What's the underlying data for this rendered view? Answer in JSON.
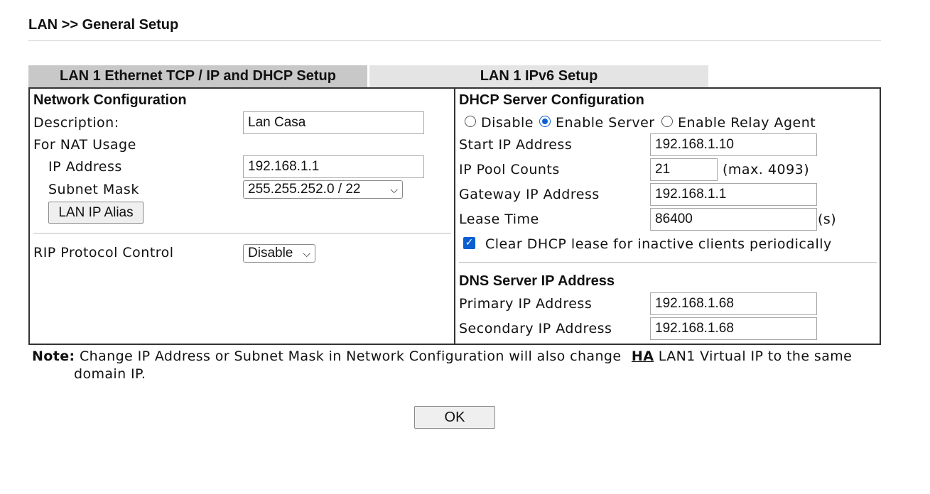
{
  "page": {
    "title": "LAN >> General Setup"
  },
  "tabs": [
    {
      "label": "LAN 1 Ethernet TCP / IP and DHCP Setup",
      "active": true
    },
    {
      "label": "LAN 1 IPv6 Setup",
      "active": false
    }
  ],
  "network": {
    "heading": "Network Configuration",
    "description_label": "Description:",
    "description_value": "Lan Casa",
    "nat_label": "For NAT Usage",
    "ip_label": "IP Address",
    "ip_value": "192.168.1.1",
    "subnet_label": "Subnet Mask",
    "subnet_value": "255.255.252.0 / 22",
    "alias_button": "LAN IP Alias",
    "rip_label": "RIP Protocol Control",
    "rip_value": "Disable"
  },
  "dhcp": {
    "heading": "DHCP Server Configuration",
    "mode_options": [
      "Disable",
      "Enable Server",
      "Enable Relay Agent"
    ],
    "selected_mode": "Enable Server",
    "start_ip_label": "Start IP Address",
    "start_ip_value": "192.168.1.10",
    "pool_label": "IP Pool Counts",
    "pool_value": "21",
    "pool_max": "(max. 4093)",
    "gateway_label": "Gateway IP Address",
    "gateway_value": "192.168.1.1",
    "lease_label": "Lease Time",
    "lease_value": "86400",
    "lease_unit": "(s)",
    "clear_lease_label": "Clear DHCP lease for inactive clients periodically",
    "clear_lease_checked": true
  },
  "dns": {
    "heading": "DNS Server IP Address",
    "primary_label": "Primary IP Address",
    "primary_value": "192.168.1.68",
    "secondary_label": "Secondary IP Address",
    "secondary_value": "192.168.1.68"
  },
  "note": {
    "prefix": "Note:",
    "text_before": "Change IP Address or Subnet Mask in Network Configuration will also change",
    "link": "HA",
    "text_after": "LAN1 Virtual IP to the same",
    "line2": "domain IP."
  },
  "ok_button": "OK",
  "colors": {
    "accent": "#0a5fd1",
    "active_tab": "#c8c8c8",
    "inactive_tab": "#e4e4e4"
  }
}
